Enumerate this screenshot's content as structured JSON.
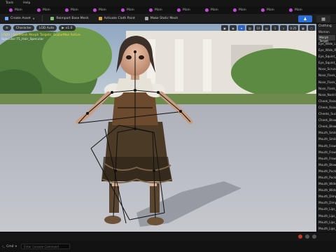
{
  "menu": {
    "items": [
      "Tools",
      "Help"
    ]
  },
  "tabs": [
    {
      "label": "Main"
    },
    {
      "label": "Main"
    },
    {
      "label": "Main"
    },
    {
      "label": "Main"
    },
    {
      "label": "Main"
    },
    {
      "label": "Main"
    },
    {
      "label": "Main"
    },
    {
      "label": "Main"
    },
    {
      "label": "Main"
    },
    {
      "label": "Main"
    },
    {
      "label": "Main"
    }
  ],
  "toolbar": {
    "create_asset": "Create Asset",
    "reimport": "Reimport Base Mesh",
    "activate_cloth": "Activate Cloth Paint",
    "make_static": "Make Static Mesh"
  },
  "viewport": {
    "perspective_label": "Character",
    "lod_label": "LOD Auto",
    "speed_label": "x1.0",
    "overlay_line1": "LOD0 | SkelMesh Morph Targets: ScalarMax Active",
    "overlay_line2": "Specular:75_Hair_Specular",
    "right_buttons": [
      "▣",
      "◉",
      "⌖",
      "▧",
      "10",
      "▤",
      "1",
      "↓",
      "0.25",
      "▦",
      "▢"
    ]
  },
  "sidepanel": {
    "header": "Clothing",
    "subheader": "Woman",
    "selected": "Morph Target",
    "items": [
      "Eye_Wide_L",
      "Eye_Wide_R",
      "Eye_Squint_L",
      "Eye_Squint_R",
      "Nose_Scrunch",
      "Nose_Flank_L",
      "Nose_Flank_R",
      "Nose_Flank_Raise",
      "Nose_Nostril",
      "Cheek_Raise_L",
      "Cheek_Raise_R",
      "Cheeks_Suck",
      "Cheek_Blow_L",
      "Cheek_Blow_R",
      "Mouth_Smile_L",
      "Mouth_Smile_R",
      "Mouth_Frown_L",
      "Mouth_Frown_R",
      "Mouth_Frown_M",
      "Mouth_Blow",
      "Mouth_Pucker",
      "Mouth_Pucker_R",
      "Mouth_Widen",
      "Mouth_Widen_R",
      "Mouth_Dimple",
      "Mouth_Dimple_R",
      "Mouth_Lips_T",
      "Mouth_Lips_B",
      "Mouth_Lips_Open",
      "Mouth_Lips_Close",
      "Mouth_Bottom"
    ]
  },
  "statusbar": {
    "cmd_label": "Cmd",
    "input_placeholder": "Enter Console Command"
  },
  "colors": {
    "tab_icon": "#c24fd6",
    "accent_blue": "#2a6fd1",
    "overlay_yellow": "#f5d547",
    "bone_lines": "#111111"
  }
}
